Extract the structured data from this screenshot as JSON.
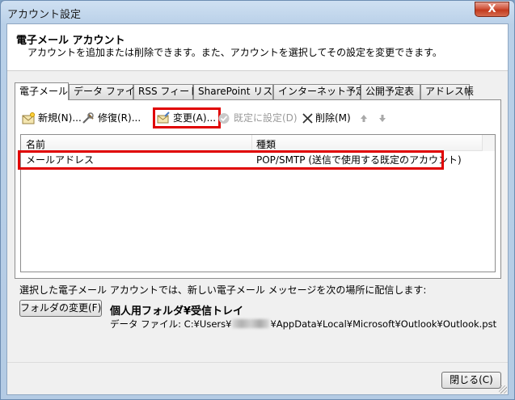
{
  "window": {
    "title": "アカウント設定",
    "close_glyph": "X"
  },
  "header": {
    "title": "電子メール アカウント",
    "description": "アカウントを追加または削除できます。また、アカウントを選択してその設定を変更できます。"
  },
  "tabs": [
    {
      "label": "電子メール",
      "active": true
    },
    {
      "label": "データ ファイル"
    },
    {
      "label": "RSS フィード"
    },
    {
      "label": "SharePoint リスト"
    },
    {
      "label": "インターネット予定表"
    },
    {
      "label": "公開予定表"
    },
    {
      "label": "アドレス帳"
    }
  ],
  "toolbar": {
    "new_label": "新規(N)...",
    "repair_label": "修復(R)...",
    "change_label": "変更(A)...",
    "default_label": "既定に設定(D)",
    "delete_label": "削除(M)",
    "up_icon": "arrow-up-icon",
    "down_icon": "arrow-down-icon"
  },
  "list": {
    "columns": [
      "名前",
      "種類"
    ],
    "rows": [
      {
        "name": "メールアドレス",
        "type": "POP/SMTP (送信で使用する既定のアカウント)"
      }
    ]
  },
  "delivery": {
    "text": "選択した電子メール アカウントでは、新しい電子メール メッセージを次の場所に配信します:",
    "change_folder_label": "フォルダの変更(F)",
    "folder_path": "個人用フォルダ¥受信トレイ",
    "data_file_prefix": "データ ファイル: C:¥Users¥",
    "data_file_suffix": "¥AppData¥Local¥Microsoft¥Outlook¥Outlook.pst"
  },
  "footer": {
    "close_label": "閉じる(C)"
  },
  "colors": {
    "highlight": "#e00000",
    "title_bar": "#b9d0e8"
  }
}
